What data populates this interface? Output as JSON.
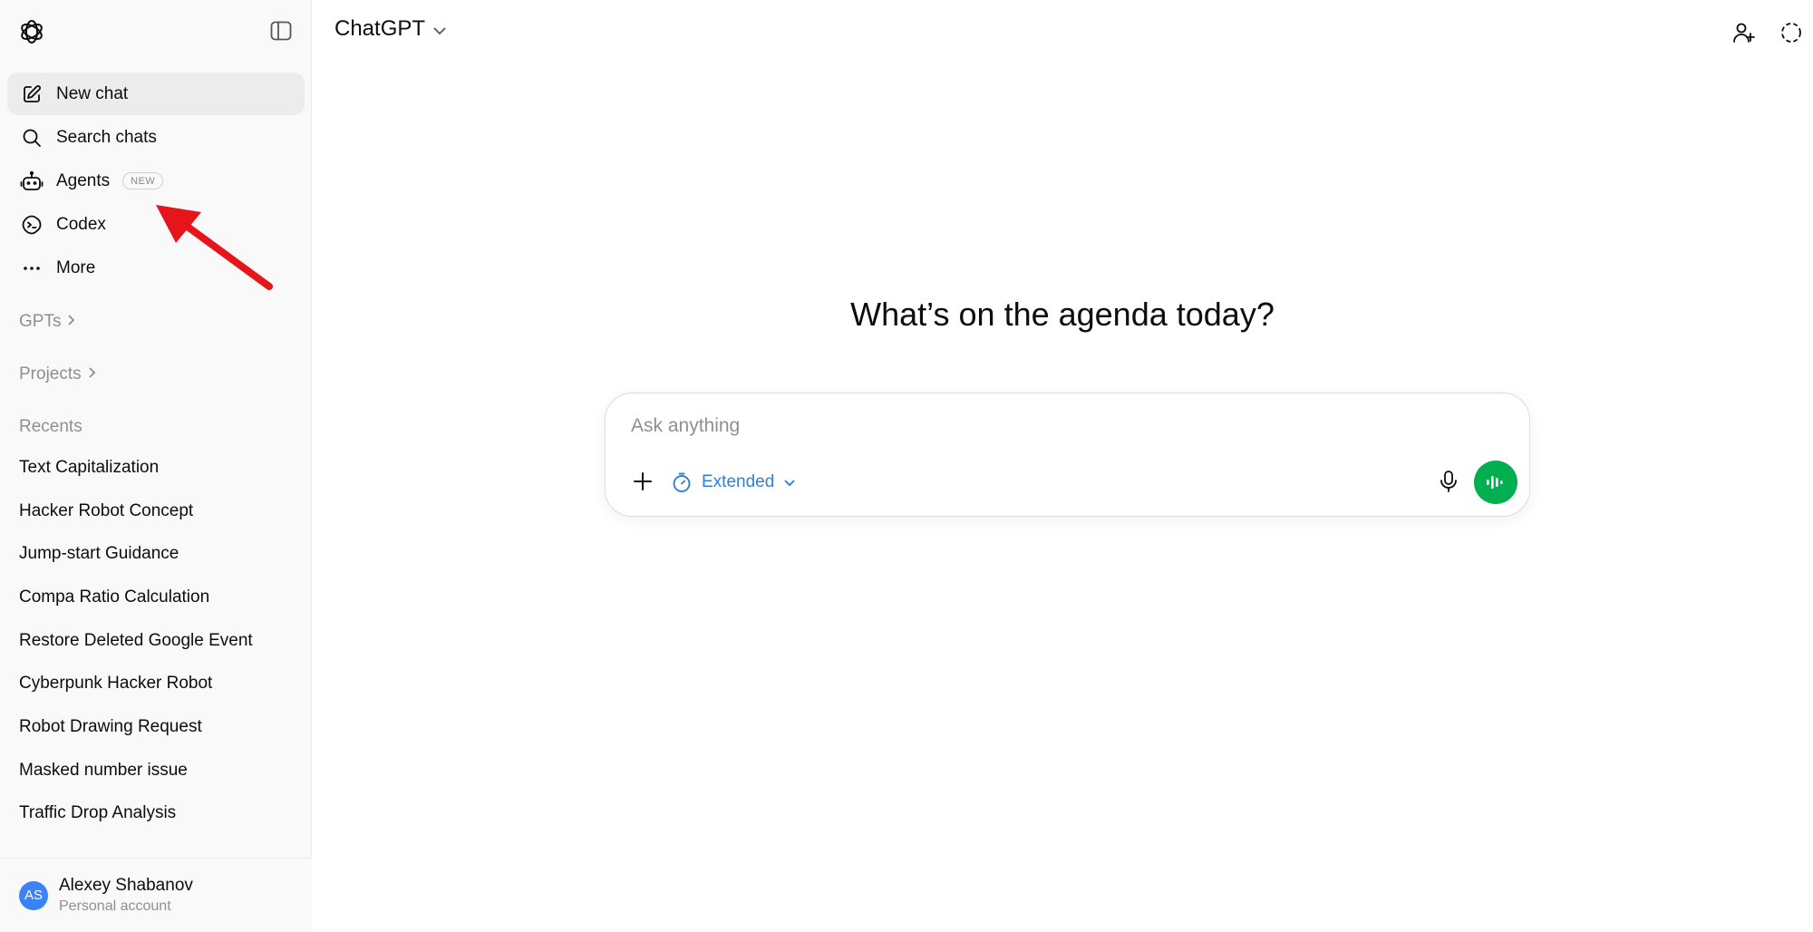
{
  "sidebar": {
    "nav": [
      {
        "label": "New chat",
        "icon": "edit-icon"
      },
      {
        "label": "Search chats",
        "icon": "search-icon"
      },
      {
        "label": "Agents",
        "icon": "robot-icon",
        "badge": "NEW"
      },
      {
        "label": "Codex",
        "icon": "codex-icon"
      },
      {
        "label": "More",
        "icon": "more-icon"
      }
    ],
    "gpts_label": "GPTs",
    "projects_label": "Projects",
    "recents_label": "Recents",
    "recents": [
      "Text Capitalization",
      "Hacker Robot Concept",
      "Jump-start Guidance",
      "Compa Ratio Calculation",
      "Restore Deleted Google Event",
      "Cyberpunk Hacker Robot",
      "Robot Drawing Request",
      "Masked number issue",
      "Traffic Drop Analysis"
    ],
    "account": {
      "initials": "AS",
      "name": "Alexey Shabanov",
      "type": "Personal account"
    }
  },
  "header": {
    "model": "ChatGPT"
  },
  "main": {
    "headline": "What’s on the agenda today?",
    "composer": {
      "placeholder": "Ask anything",
      "mode_label": "Extended"
    }
  },
  "colors": {
    "accent_blue": "#2f7fd8",
    "voice_green": "#00b050",
    "annotation_red": "#e8141c",
    "avatar_blue": "#3b82f6"
  }
}
